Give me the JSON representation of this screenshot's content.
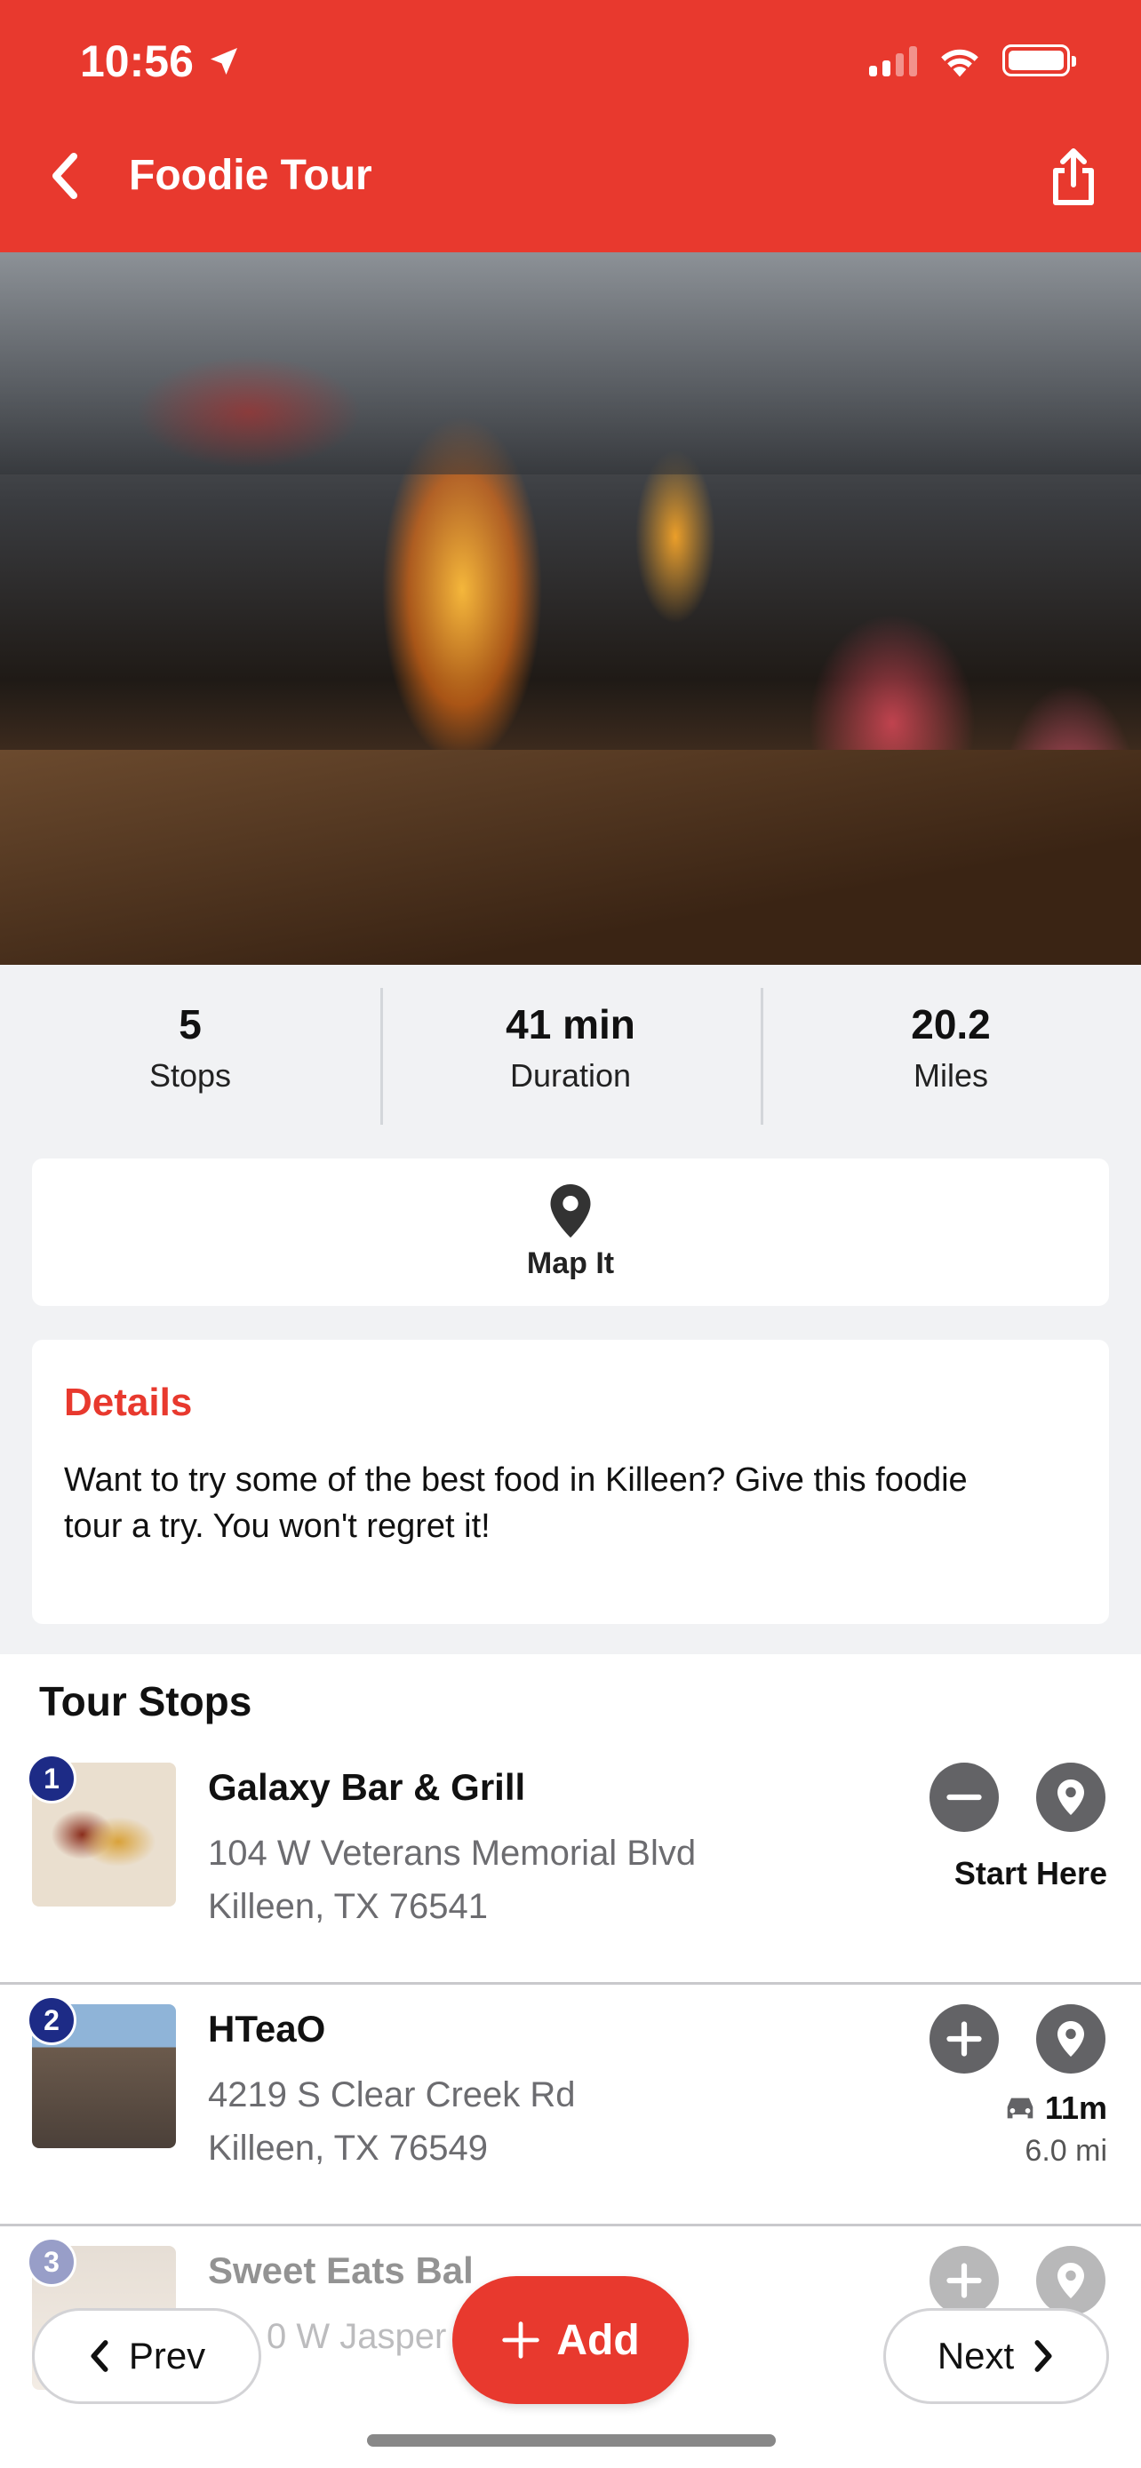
{
  "status_bar": {
    "time": "10:56"
  },
  "nav": {
    "title": "Foodie Tour"
  },
  "stats": [
    {
      "value": "5",
      "label": "Stops"
    },
    {
      "value": "41 min",
      "label": "Duration"
    },
    {
      "value": "20.2",
      "label": "Miles"
    }
  ],
  "map_it": {
    "label": "Map It"
  },
  "details": {
    "title": "Details",
    "text": "Want to try some of the best food in Killeen? Give this foodie tour a try. You won't regret it!"
  },
  "tour_stops": {
    "title": "Tour Stops",
    "items": [
      {
        "number": "1",
        "name": "Galaxy Bar & Grill",
        "address_line1": "104 W Veterans Memorial Blvd",
        "address_line2": "Killeen, TX 76541",
        "start_label": "Start Here"
      },
      {
        "number": "2",
        "name": "HTeaO",
        "address_line1": "4219 S Clear Creek Rd",
        "address_line2": "Killeen, TX 76549",
        "drive_time": "11m",
        "drive_distance": "6.0 mi"
      },
      {
        "number": "3",
        "name": "Sweet Eats Bal",
        "address_line1": "0 W Jasper"
      }
    ]
  },
  "bottom_bar": {
    "prev_label": "Prev",
    "add_label": "Add",
    "next_label": "Next"
  },
  "colors": {
    "brand": "#e8392e",
    "badge": "#1d2b86",
    "icon_button": "#636366"
  }
}
